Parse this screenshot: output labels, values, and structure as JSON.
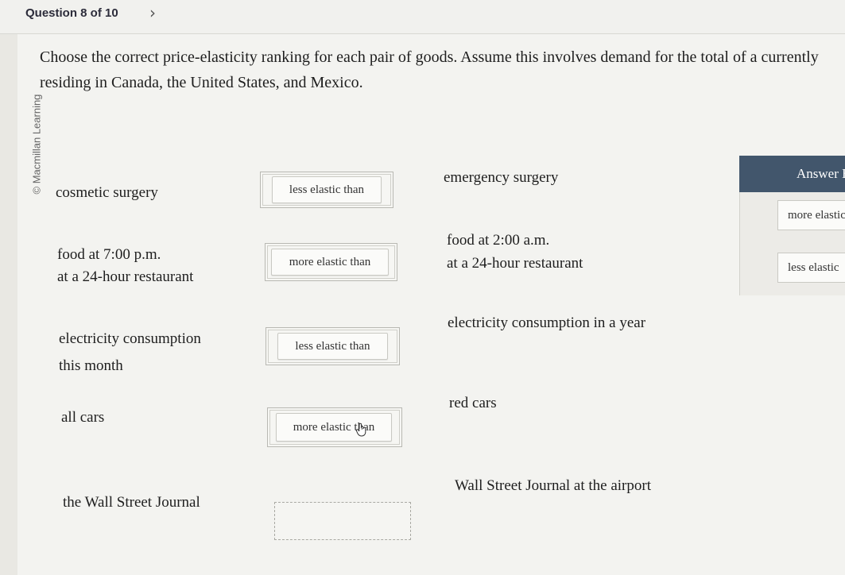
{
  "header": {
    "question_label": "Question 8 of 10",
    "next_icon": "chevron-right-icon"
  },
  "copyright": "© Macmillan Learning",
  "prompt": "Choose the correct price-elasticity ranking for each pair of goods. Assume this involves demand for the total of a currently residing in Canada, the United States, and Mexico.",
  "pairs": [
    {
      "left": "cosmetic surgery",
      "answer": "less elastic than",
      "right": "emergency surgery"
    },
    {
      "left_line1": "food at 7:00 p.m.",
      "left_line2": "at a 24-hour restaurant",
      "answer": "more elastic than",
      "right_line1": "food at 2:00 a.m.",
      "right_line2": "at a 24-hour restaurant"
    },
    {
      "left_line1": "electricity consumption",
      "left_line2": "this month",
      "answer": "less elastic than",
      "right": "electricity consumption in a year"
    },
    {
      "left": "all cars",
      "answer": "more elastic than",
      "right": "red cars"
    },
    {
      "left": "the Wall Street Journal",
      "answer": "",
      "right": "Wall Street Journal at the airport"
    }
  ],
  "answer_bank": {
    "title": "Answer B",
    "options": [
      "more elastic",
      "less elastic"
    ]
  },
  "colors": {
    "bank_header": "#42566c",
    "background": "#e9e8e3"
  }
}
